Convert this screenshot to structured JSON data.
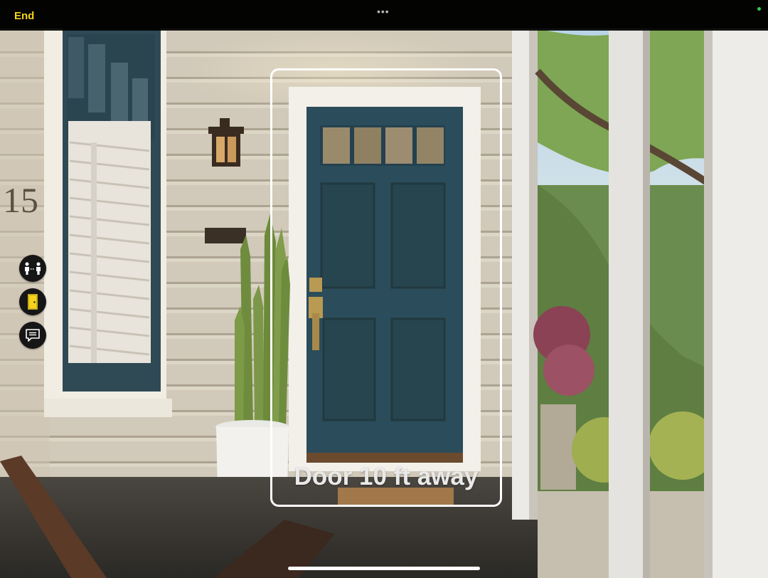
{
  "topbar": {
    "end_label": "End",
    "more_icon": "ellipsis-icon",
    "more_text": "•••",
    "camera_indicator_color": "#2cd04c"
  },
  "side_tools": [
    {
      "name": "people-detection-button",
      "icon": "people-distance-icon"
    },
    {
      "name": "door-detection-button",
      "icon": "door-icon",
      "accent": "#f5d21b"
    },
    {
      "name": "text-detection-button",
      "icon": "text-bubble-icon"
    }
  ],
  "scene": {
    "house_number": "15"
  },
  "detection": {
    "label": "Door 10 ft away"
  },
  "colors": {
    "accent": "#f5d21b",
    "door": "#2b4c5a",
    "siding": "#e3dccb"
  }
}
